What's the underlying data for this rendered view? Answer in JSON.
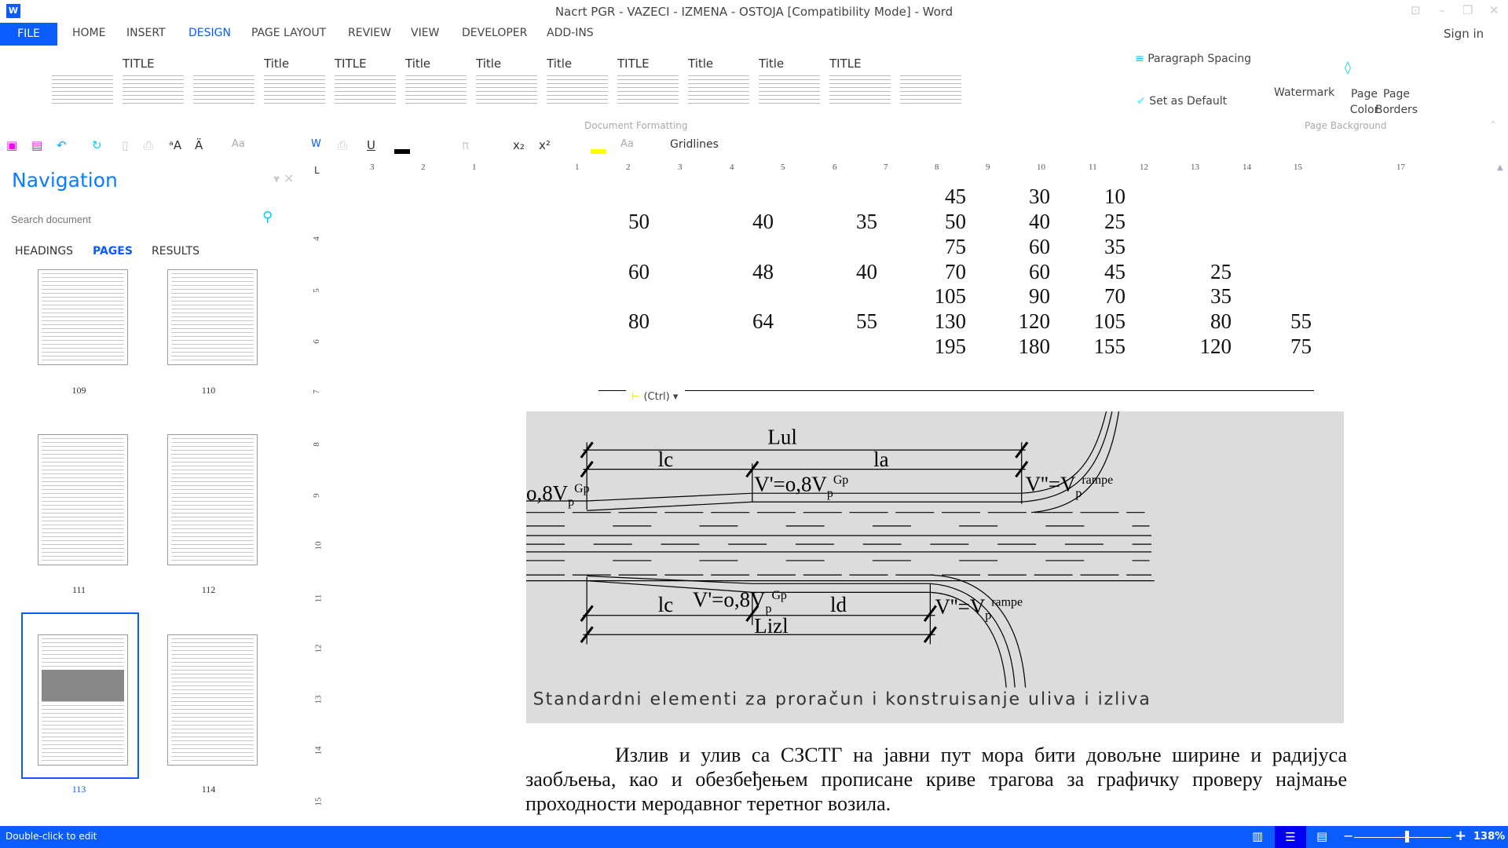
{
  "window": {
    "title": "Nacrt PGR - VAZECI - IZMENA - OSTOJA [Compatibility Mode] - Word",
    "sign_in": "Sign in"
  },
  "tabs": [
    "FILE",
    "HOME",
    "INSERT",
    "DESIGN",
    "PAGE LAYOUT",
    "REVIEW",
    "VIEW",
    "DEVELOPER",
    "ADD-INS"
  ],
  "active_tab": "DESIGN",
  "accent": "#0a5cff",
  "ribbon": {
    "gallery": [
      "",
      "TITLE",
      "",
      "Title",
      "TITLE",
      "Title",
      "Title",
      "Title",
      "TITLE",
      "Title",
      "Title",
      "TITLE",
      ""
    ],
    "document_formatting": "Document Formatting",
    "paragraph_spacing": "Paragraph Spacing",
    "set_as_default": "Set as Default",
    "watermark": "Watermark",
    "page_color": "Page Color",
    "page_borders": "Page Borders",
    "page_background": "Page Background"
  },
  "toolbar": {
    "aa": "Aa",
    "aa2": "Aa",
    "gridlines": "Gridlines",
    "underline": "U",
    "pi": "π",
    "sub": "x₂",
    "sup": "x²"
  },
  "navigation": {
    "title": "Navigation",
    "search_placeholder": "Search document",
    "tabs": [
      "HEADINGS",
      "PAGES",
      "RESULTS"
    ],
    "active_tab": "PAGES",
    "pages": [
      "109",
      "110",
      "111",
      "112",
      "113",
      "114"
    ],
    "selected_page": "113"
  },
  "ruler": {
    "h": [
      "3",
      "2",
      "1",
      "1",
      "2",
      "3",
      "4",
      "5",
      "6",
      "7",
      "8",
      "9",
      "10",
      "11",
      "12",
      "13",
      "14",
      "15",
      "17"
    ],
    "v": [
      "4",
      "5",
      "6",
      "7",
      "8",
      "9",
      "10",
      "11",
      "12",
      "13",
      "14",
      "15"
    ]
  },
  "table": {
    "rows": [
      [
        "",
        "",
        "",
        "45",
        "30",
        "10",
        "",
        ""
      ],
      [
        "50",
        "40",
        "35",
        "50",
        "40",
        "25",
        "",
        ""
      ],
      [
        "",
        "",
        "",
        "75",
        "60",
        "35",
        "",
        ""
      ],
      [
        "60",
        "48",
        "40",
        "70",
        "60",
        "45",
        "25",
        ""
      ],
      [
        "",
        "",
        "",
        "105",
        "90",
        "70",
        "35",
        ""
      ],
      [
        "80",
        "64",
        "55",
        "130",
        "120",
        "105",
        "80",
        "55"
      ],
      [
        "",
        "",
        "",
        "195",
        "180",
        "155",
        "120",
        "75"
      ]
    ]
  },
  "paste_options": "(Ctrl)",
  "figure": {
    "labels": {
      "lul": "Lul",
      "lc": "lc",
      "la": "la",
      "ld": "ld",
      "lizl": "Lizl",
      "v08": "o,8V",
      "vp": "V'=o,8V",
      "vpp": "V''=V",
      "sub": "p",
      "gp": "Gp",
      "rampe": "rampe"
    },
    "caption": "Standardni elementi za proračun i konstruisanje uliva i izliva"
  },
  "paragraph": "Излив и улив са СЗСТГ на јавни пут мора бити довољне ширине и радијуса заобљења, као и обезбеђењем прописане криве трагова за графичку проверу најмање проходности меродавног теретног возила.",
  "status": {
    "left": "Double-click to edit",
    "zoom": "138%",
    "zoom_level": 138
  }
}
